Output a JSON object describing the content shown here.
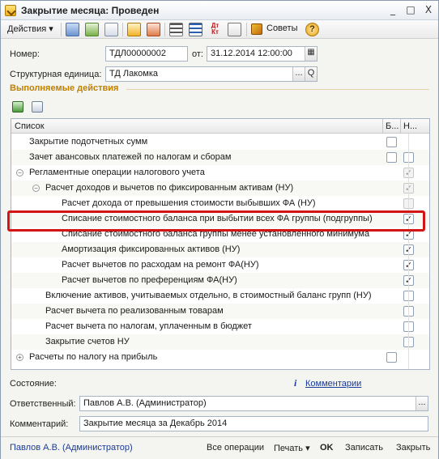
{
  "window": {
    "title": "Закрытие месяца: Проведен",
    "minimize_label": "_",
    "maximize_label": "□",
    "close_label": "X"
  },
  "toolbar": {
    "actions_label": "Действия ▾",
    "sovety_label": "Советы",
    "help_label": "?",
    "icons": [
      "save-icon",
      "refresh-icon",
      "new-doc-icon",
      "post-icon",
      "unpost-icon",
      "list-icon",
      "structure-icon",
      "dt-kt-icon",
      "report-icon"
    ]
  },
  "header": {
    "number_label": "Номер:",
    "number_value": "ТДЛ00000002",
    "date_label": "от:",
    "date_value": "31.12.2014 12:00:00",
    "unit_label": "Структурная единица:",
    "unit_value": "ТД Лакомка",
    "unit_select_btn": "...",
    "unit_search_btn": "Q"
  },
  "section": {
    "title": "Выполняемые действия"
  },
  "table": {
    "col_list": "Список",
    "col_b": "Б...",
    "col_n": "Н...",
    "rows": [
      {
        "text": "Закрытие подотчетных сумм",
        "b": "unchecked",
        "n": "none"
      },
      {
        "text": "Зачет авансовых платежей по налогам и сборам",
        "b": "unchecked",
        "n": "unchecked"
      },
      {
        "text": "Регламентные операции налогового учета",
        "b": "none",
        "n": "checked-disabled",
        "expander": "⊖"
      },
      {
        "text": "Расчет доходов и вычетов по фиксированным активам (НУ)",
        "b": "none",
        "n": "checked-disabled",
        "expander": "⊖"
      },
      {
        "text": "Расчет дохода от превышения стоимости выбывших ФА (НУ)",
        "b": "none",
        "n": "unchecked-disabled"
      },
      {
        "text": "Списание стоимостного баланса при выбытии всех ФА группы (подгруппы)",
        "b": "none",
        "n": "checked"
      },
      {
        "text": "Списание стоимостного баланса группы менее установленного минимума",
        "b": "none",
        "n": "checked"
      },
      {
        "text": "Амортизация фиксированных активов (НУ)",
        "b": "none",
        "n": "checked"
      },
      {
        "text": "Расчет вычетов по расходам на ремонт ФА(НУ)",
        "b": "none",
        "n": "checked"
      },
      {
        "text": "Расчет вычетов по преференциям ФА(НУ)",
        "b": "none",
        "n": "checked"
      },
      {
        "text": "Включение активов, учитываемых отдельно, в стоимостный баланс групп (НУ)",
        "b": "none",
        "n": "unchecked"
      },
      {
        "text": "Расчет вычета по реализованным товарам",
        "b": "none",
        "n": "unchecked"
      },
      {
        "text": "Расчет вычета по налогам, уплаченным в бюджет",
        "b": "none",
        "n": "unchecked"
      },
      {
        "text": "Закрытие счетов НУ",
        "b": "none",
        "n": "unchecked"
      },
      {
        "text": "Расчеты по налогу на прибыль",
        "b": "unchecked",
        "n": "none",
        "expander": "⊕"
      }
    ]
  },
  "footer": {
    "state_label": "Состояние:",
    "comments_link": "Комментарии",
    "responsible_label": "Ответственный:",
    "responsible_value": "Павлов А.В. (Администратор)",
    "comment_label": "Комментарий:",
    "comment_value": "Закрытие месяца за Декабрь 2014"
  },
  "bottombar": {
    "user": "Павлов А.В. (Администратор)",
    "all_ops": "Все операции",
    "print": "Печать ▾",
    "ok": "OK",
    "write": "Записать",
    "close": "Закрыть"
  }
}
